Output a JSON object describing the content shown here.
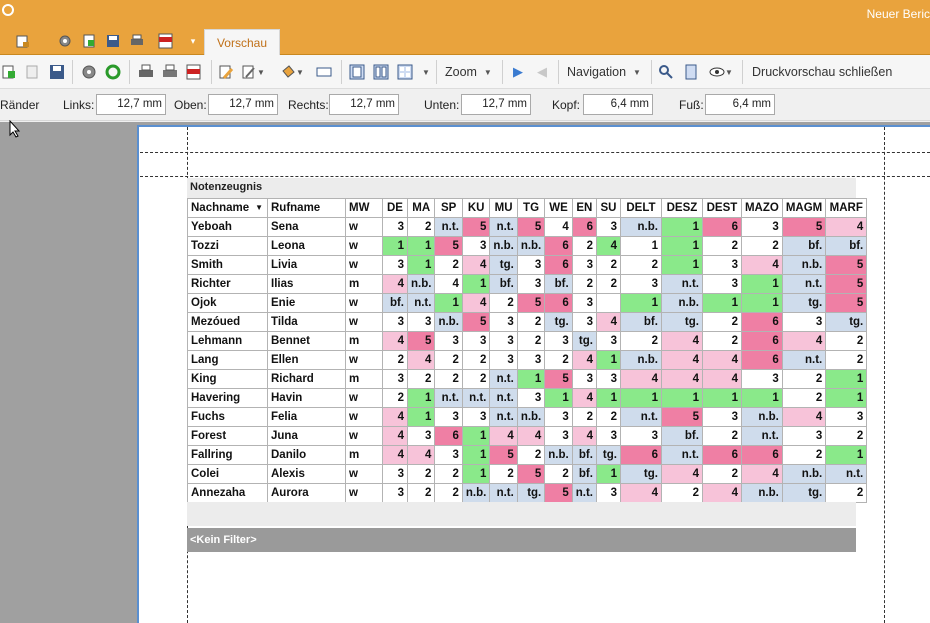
{
  "window": {
    "title": "Neuer Beric"
  },
  "ribbon_tab": "Vorschau",
  "toolbar": {
    "zoom_label": "Zoom",
    "navigation_label": "Navigation",
    "close_preview_label": "Druckvorschau schließen",
    "icons": [
      "add-icon",
      "copy-icon",
      "save-icon",
      "gear-icon",
      "refresh-icon",
      "print-icon",
      "print-setup-icon",
      "pdf-icon",
      "edit-icon",
      "paint-icon",
      "bucket-icon",
      "field-icon",
      "single-page-icon",
      "two-page-icon",
      "multi-page-icon",
      "next-icon",
      "prev-icon",
      "find-icon",
      "page-icon",
      "eye-icon"
    ]
  },
  "margins": {
    "section_label": "Ränder",
    "left_label": "Links:",
    "left_value": "12,7 mm",
    "top_label": "Oben:",
    "top_value": "12,7 mm",
    "right_label": "Rechts:",
    "right_value": "12,7 mm",
    "bottom_label": "Unten:",
    "bottom_value": "12,7 mm",
    "header_label": "Kopf:",
    "header_value": "6,4 mm",
    "footer_label": "Fuß:",
    "footer_value": "6,4 mm"
  },
  "report": {
    "title": "Notenzeugnis",
    "filter_label": "<Kein Filter>",
    "columns": [
      "Nachname",
      "Rufname",
      "MW",
      "DE",
      "MA",
      "SP",
      "KU",
      "MU",
      "TG",
      "WE",
      "EN",
      "SU",
      "DELT",
      "DESZ",
      "DEST",
      "MAZO",
      "MAGM",
      "MARF"
    ],
    "rows": [
      [
        "Yeboah",
        "Sena",
        "w",
        "3",
        "2",
        "n.t.",
        "5",
        "n.t.",
        "5",
        "4",
        "6",
        "3",
        "n.b.",
        "1",
        "6",
        "3",
        "5",
        "4"
      ],
      [
        "Tozzi",
        "Leona",
        "w",
        "1",
        "1",
        "5",
        "3",
        "n.b.",
        "n.b.",
        "6",
        "2",
        "4",
        "1",
        "1",
        "2",
        "2",
        "bf.",
        "bf."
      ],
      [
        "Smith",
        "Livia",
        "w",
        "3",
        "1",
        "2",
        "4",
        "tg.",
        "3",
        "6",
        "3",
        "2",
        "2",
        "1",
        "3",
        "4",
        "n.b.",
        "5"
      ],
      [
        "Richter",
        "Ilias",
        "m",
        "4",
        "n.b.",
        "4",
        "1",
        "bf.",
        "3",
        "bf.",
        "2",
        "2",
        "3",
        "n.t.",
        "3",
        "1",
        "n.t.",
        "5"
      ],
      [
        "Ojok",
        "Enie",
        "w",
        "bf.",
        "n.t.",
        "1",
        "4",
        "2",
        "5",
        "6",
        "3",
        "",
        "1",
        "n.b.",
        "1",
        "1",
        "tg.",
        "5"
      ],
      [
        "Mezóued",
        "Tilda",
        "w",
        "3",
        "3",
        "n.b.",
        "5",
        "3",
        "2",
        "tg.",
        "3",
        "4",
        "bf.",
        "tg.",
        "2",
        "6",
        "3",
        "tg."
      ],
      [
        "Lehmann",
        "Bennet",
        "m",
        "4",
        "5",
        "3",
        "3",
        "3",
        "2",
        "3",
        "tg.",
        "3",
        "2",
        "4",
        "2",
        "6",
        "4",
        "2"
      ],
      [
        "Lang",
        "Ellen",
        "w",
        "2",
        "4",
        "2",
        "2",
        "3",
        "3",
        "2",
        "4",
        "1",
        "n.b.",
        "4",
        "4",
        "6",
        "n.t.",
        "2"
      ],
      [
        "King",
        "Richard",
        "m",
        "3",
        "2",
        "2",
        "2",
        "n.t.",
        "1",
        "5",
        "3",
        "3",
        "4",
        "4",
        "4",
        "3",
        "2",
        "1"
      ],
      [
        "Havering",
        "Havin",
        "w",
        "2",
        "1",
        "n.t.",
        "n.t.",
        "n.t.",
        "3",
        "1",
        "4",
        "1",
        "1",
        "1",
        "1",
        "1",
        "2",
        "1"
      ],
      [
        "Fuchs",
        "Felia",
        "w",
        "4",
        "1",
        "3",
        "3",
        "n.t.",
        "n.b.",
        "3",
        "2",
        "2",
        "n.t.",
        "5",
        "3",
        "n.b.",
        "4",
        "3"
      ],
      [
        "Forest",
        "Juna",
        "w",
        "4",
        "3",
        "6",
        "1",
        "4",
        "4",
        "3",
        "4",
        "3",
        "3",
        "bf.",
        "2",
        "n.t.",
        "3",
        "2"
      ],
      [
        "Fallring",
        "Danilo",
        "m",
        "4",
        "4",
        "3",
        "1",
        "5",
        "2",
        "n.b.",
        "bf.",
        "tg.",
        "6",
        "n.t.",
        "6",
        "6",
        "2",
        "1"
      ],
      [
        "Colei",
        "Alexis",
        "w",
        "3",
        "2",
        "2",
        "1",
        "2",
        "5",
        "2",
        "bf.",
        "1",
        "tg.",
        "4",
        "2",
        "4",
        "n.b.",
        "n.t."
      ],
      [
        "Annezaha",
        "Aurora",
        "w",
        "3",
        "2",
        "2",
        "n.b.",
        "n.t.",
        "tg.",
        "5",
        "n.t.",
        "3",
        "4",
        "2",
        "4",
        "n.b.",
        "tg.",
        "2"
      ]
    ],
    "colors": [
      [
        "w",
        "w",
        "w",
        "w",
        "w",
        "b",
        "r",
        "b",
        "r",
        "w",
        "r",
        "w",
        "b",
        "g",
        "r",
        "w",
        "r",
        "p"
      ],
      [
        "w",
        "w",
        "w",
        "g",
        "g",
        "r",
        "w",
        "b",
        "b",
        "r",
        "w",
        "g",
        "w",
        "g",
        "w",
        "w",
        "b",
        "b"
      ],
      [
        "w",
        "w",
        "w",
        "w",
        "g",
        "w",
        "p",
        "b",
        "w",
        "r",
        "w",
        "w",
        "w",
        "g",
        "w",
        "p",
        "b",
        "r"
      ],
      [
        "w",
        "w",
        "w",
        "p",
        "b",
        "w",
        "g",
        "b",
        "w",
        "b",
        "w",
        "w",
        "w",
        "b",
        "w",
        "g",
        "b",
        "r"
      ],
      [
        "w",
        "w",
        "w",
        "b",
        "b",
        "g",
        "p",
        "w",
        "r",
        "r",
        "w",
        "w",
        "g",
        "b",
        "g",
        "g",
        "b",
        "r"
      ],
      [
        "w",
        "w",
        "w",
        "w",
        "w",
        "b",
        "r",
        "w",
        "w",
        "b",
        "w",
        "p",
        "b",
        "b",
        "w",
        "r",
        "w",
        "b"
      ],
      [
        "w",
        "w",
        "w",
        "p",
        "r",
        "w",
        "w",
        "w",
        "w",
        "w",
        "b",
        "w",
        "w",
        "p",
        "w",
        "r",
        "p",
        "w"
      ],
      [
        "w",
        "w",
        "w",
        "w",
        "p",
        "w",
        "w",
        "w",
        "w",
        "w",
        "p",
        "g",
        "b",
        "p",
        "p",
        "r",
        "b",
        "w"
      ],
      [
        "w",
        "w",
        "w",
        "w",
        "w",
        "w",
        "w",
        "b",
        "g",
        "r",
        "w",
        "w",
        "p",
        "p",
        "p",
        "w",
        "w",
        "g"
      ],
      [
        "w",
        "w",
        "w",
        "w",
        "g",
        "b",
        "b",
        "b",
        "w",
        "g",
        "p",
        "g",
        "g",
        "g",
        "g",
        "g",
        "w",
        "g"
      ],
      [
        "w",
        "w",
        "w",
        "p",
        "g",
        "w",
        "w",
        "b",
        "b",
        "w",
        "w",
        "w",
        "b",
        "r",
        "w",
        "b",
        "p",
        "w"
      ],
      [
        "w",
        "w",
        "w",
        "p",
        "w",
        "r",
        "g",
        "p",
        "p",
        "w",
        "p",
        "w",
        "w",
        "b",
        "w",
        "b",
        "w",
        "w"
      ],
      [
        "w",
        "w",
        "w",
        "p",
        "p",
        "w",
        "g",
        "r",
        "w",
        "b",
        "b",
        "b",
        "r",
        "b",
        "r",
        "r",
        "w",
        "g"
      ],
      [
        "w",
        "w",
        "w",
        "w",
        "w",
        "w",
        "g",
        "w",
        "r",
        "w",
        "b",
        "g",
        "b",
        "p",
        "w",
        "p",
        "b",
        "b"
      ],
      [
        "w",
        "w",
        "w",
        "w",
        "w",
        "w",
        "b",
        "b",
        "b",
        "r",
        "b",
        "w",
        "p",
        "w",
        "p",
        "b",
        "b",
        "w"
      ]
    ]
  },
  "palette": {
    "pink": "#f7c3d9",
    "red": "#ef7fa4",
    "green": "#8ae98a",
    "blue": "#cfdcec",
    "accent": "#e9a33d"
  }
}
